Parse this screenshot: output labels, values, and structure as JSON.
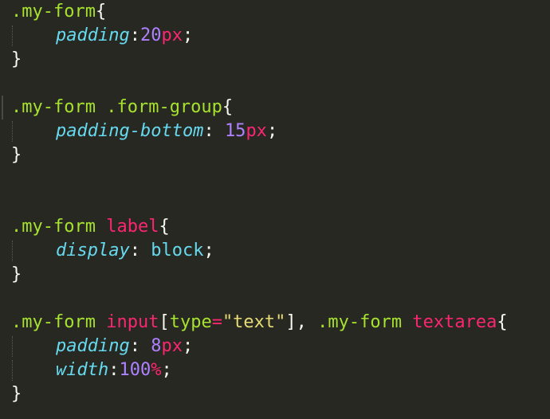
{
  "editor": {
    "theme": "monokai",
    "colors": {
      "background": "#272822",
      "selector": "#a6e22e",
      "tag": "#f92672",
      "property": "#66d9ef",
      "number": "#ae81ff",
      "unit": "#f92672",
      "string": "#e6db74",
      "text": "#f8f8f2"
    },
    "lines": [
      {
        "id": "l1",
        "tokens": [
          {
            "t": ".my-form",
            "c": "sel"
          },
          {
            "t": "{",
            "c": "br"
          }
        ]
      },
      {
        "id": "l2",
        "indent": true,
        "tokens": [
          {
            "t": "padding",
            "c": "prop"
          },
          {
            "t": ":",
            "c": "br"
          },
          {
            "t": "20",
            "c": "num"
          },
          {
            "t": "px",
            "c": "unit"
          },
          {
            "t": ";",
            "c": "br"
          }
        ]
      },
      {
        "id": "l3",
        "tokens": [
          {
            "t": "}",
            "c": "br"
          }
        ]
      },
      {
        "id": "l4",
        "tokens": []
      },
      {
        "id": "l5",
        "tokens": [
          {
            "t": ".my-form",
            "c": "sel"
          },
          {
            "t": " ",
            "c": "br"
          },
          {
            "t": ".form-group",
            "c": "sel"
          },
          {
            "t": "{",
            "c": "br"
          }
        ]
      },
      {
        "id": "l6",
        "indent": true,
        "tokens": [
          {
            "t": "padding-bottom",
            "c": "prop"
          },
          {
            "t": ": ",
            "c": "br"
          },
          {
            "t": "15",
            "c": "num"
          },
          {
            "t": "px",
            "c": "unit"
          },
          {
            "t": ";",
            "c": "br"
          }
        ]
      },
      {
        "id": "l7",
        "tokens": [
          {
            "t": "}",
            "c": "br"
          }
        ]
      },
      {
        "id": "l8",
        "tokens": []
      },
      {
        "id": "l9",
        "tokens": []
      },
      {
        "id": "l10",
        "tokens": [
          {
            "t": ".my-form",
            "c": "sel"
          },
          {
            "t": " ",
            "c": "br"
          },
          {
            "t": "label",
            "c": "tag"
          },
          {
            "t": "{",
            "c": "br"
          }
        ]
      },
      {
        "id": "l11",
        "indent": true,
        "tokens": [
          {
            "t": "display",
            "c": "prop"
          },
          {
            "t": ": ",
            "c": "br"
          },
          {
            "t": "block",
            "c": "kw"
          },
          {
            "t": ";",
            "c": "br"
          }
        ]
      },
      {
        "id": "l12",
        "tokens": [
          {
            "t": "}",
            "c": "br"
          }
        ]
      },
      {
        "id": "l13",
        "tokens": []
      },
      {
        "id": "l14",
        "tokens": [
          {
            "t": ".my-form",
            "c": "sel"
          },
          {
            "t": " ",
            "c": "br"
          },
          {
            "t": "input",
            "c": "tag"
          },
          {
            "t": "[",
            "c": "br"
          },
          {
            "t": "type",
            "c": "attr"
          },
          {
            "t": "=",
            "c": "op"
          },
          {
            "t": "\"text\"",
            "c": "str"
          },
          {
            "t": "], ",
            "c": "br"
          },
          {
            "t": ".my-form",
            "c": "sel"
          },
          {
            "t": " ",
            "c": "br"
          },
          {
            "t": "textarea",
            "c": "tag"
          },
          {
            "t": "{",
            "c": "br"
          }
        ]
      },
      {
        "id": "l15",
        "indent": true,
        "tokens": [
          {
            "t": "padding",
            "c": "prop"
          },
          {
            "t": ": ",
            "c": "br"
          },
          {
            "t": "8",
            "c": "num"
          },
          {
            "t": "px",
            "c": "unit"
          },
          {
            "t": ";",
            "c": "br"
          }
        ]
      },
      {
        "id": "l16",
        "indent": true,
        "tokens": [
          {
            "t": "width",
            "c": "prop"
          },
          {
            "t": ":",
            "c": "br"
          },
          {
            "t": "100",
            "c": "num"
          },
          {
            "t": "%",
            "c": "unit"
          },
          {
            "t": ";",
            "c": "br"
          }
        ]
      },
      {
        "id": "l17",
        "tokens": [
          {
            "t": "}",
            "c": "br"
          }
        ]
      }
    ]
  }
}
